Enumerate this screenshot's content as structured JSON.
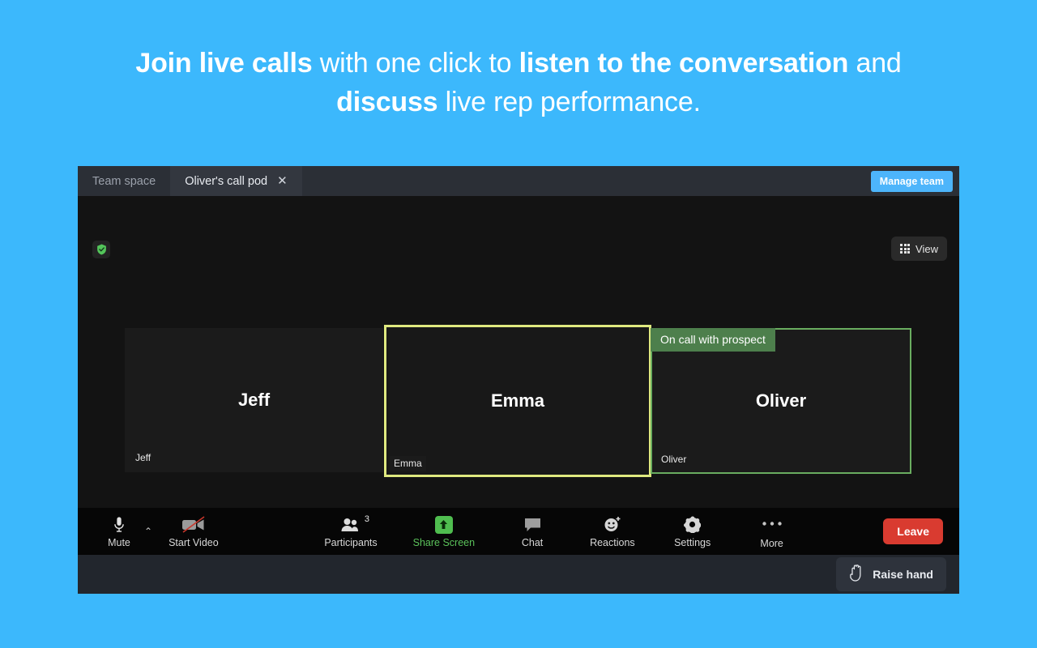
{
  "headline": {
    "segments": [
      {
        "text": "Join live calls",
        "bold": true
      },
      {
        "text": " with one click to ",
        "bold": false
      },
      {
        "text": "listen to the conversation",
        "bold": true
      },
      {
        "text": " and ",
        "bold": false
      },
      {
        "text": "discuss",
        "bold": true
      },
      {
        "text": " live rep performance.",
        "bold": false
      }
    ],
    "full_text": "Join live calls with one click to listen to the conversation and discuss live rep performance."
  },
  "colors": {
    "page_background": "#3cb8fc",
    "accent_blue": "#4db5fb",
    "active_speaker_border": "#dfe97f",
    "on_call_border": "#6aad60",
    "on_call_badge_bg": "#4d7f4c",
    "share_green": "#4fbd4f",
    "leave_red": "#d93b30",
    "shield_green": "#53c45a"
  },
  "titlebar": {
    "tabs": [
      {
        "label": "Team space",
        "active": false,
        "closable": false
      },
      {
        "label": "Oliver's call pod",
        "active": true,
        "closable": true,
        "close_glyph": "✕"
      }
    ],
    "manage_team_label": "Manage team"
  },
  "stage": {
    "shield_icon": "shield-check-icon",
    "view_button": {
      "label": "View",
      "icon": "grid-icon"
    },
    "tiles": [
      {
        "id": "jeff",
        "name": "Jeff",
        "chip": "Jeff",
        "state": "normal",
        "badge": null
      },
      {
        "id": "emma",
        "name": "Emma",
        "chip": "Emma",
        "state": "active-speaker",
        "badge": null
      },
      {
        "id": "oliver",
        "name": "Oliver",
        "chip": "Oliver",
        "state": "on-call",
        "badge": "On call with prospect"
      }
    ]
  },
  "toolbar": {
    "mute": {
      "label": "Mute",
      "icon": "microphone-icon"
    },
    "audio_chevron": {
      "glyph": "⌃",
      "icon": "chevron-up-icon"
    },
    "start_video": {
      "label": "Start Video",
      "icon": "video-off-icon"
    },
    "participants": {
      "label": "Participants",
      "count": "3",
      "icon": "participants-icon"
    },
    "share_screen": {
      "label": "Share Screen",
      "icon": "share-screen-icon"
    },
    "chat": {
      "label": "Chat",
      "icon": "chat-bubble-icon"
    },
    "reactions": {
      "label": "Reactions",
      "icon": "reactions-icon"
    },
    "settings": {
      "label": "Settings",
      "icon": "gear-icon"
    },
    "more": {
      "label": "More",
      "icon": "ellipsis-icon"
    },
    "leave": {
      "label": "Leave"
    }
  },
  "bottombar": {
    "raise_hand": {
      "label": "Raise hand",
      "icon": "raised-hand-icon"
    }
  }
}
